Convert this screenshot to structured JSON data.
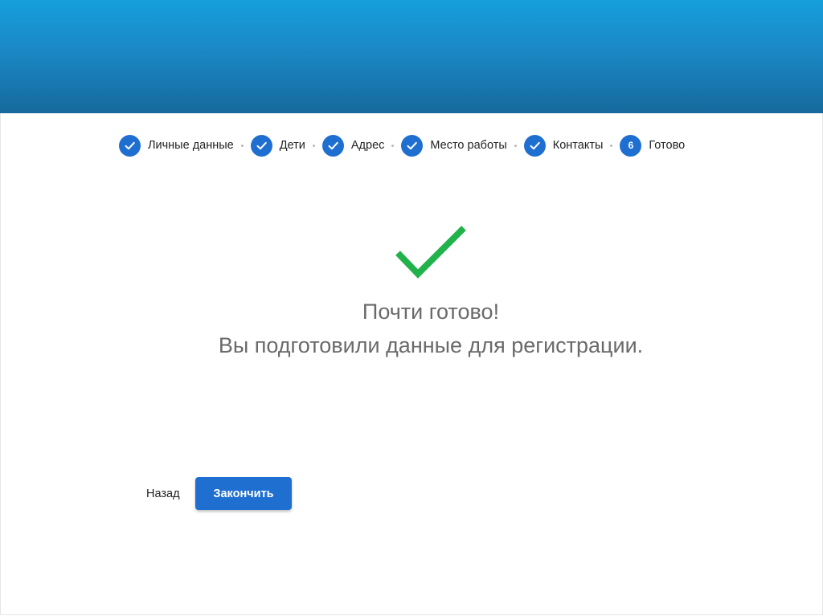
{
  "colors": {
    "header_top": "#169fdc",
    "header_bottom": "#16699d",
    "accent": "#1f6fd1",
    "success": "#22b24c",
    "message_text": "#6a6a6a"
  },
  "stepper": {
    "steps": [
      {
        "label": "Личные данные",
        "state": "done",
        "icon": "check-icon"
      },
      {
        "label": "Дети",
        "state": "done",
        "icon": "check-icon"
      },
      {
        "label": "Адрес",
        "state": "done",
        "icon": "check-icon"
      },
      {
        "label": "Место работы",
        "state": "done",
        "icon": "check-icon"
      },
      {
        "label": "Контакты",
        "state": "done",
        "icon": "check-icon"
      },
      {
        "label": "Готово",
        "state": "current",
        "number": "6"
      }
    ]
  },
  "result": {
    "icon": "success-check-icon",
    "title": "Почти готово!",
    "subtitle": "Вы подготовили данные для регистрации."
  },
  "actions": {
    "back_label": "Назад",
    "finish_label": "Закончить"
  }
}
